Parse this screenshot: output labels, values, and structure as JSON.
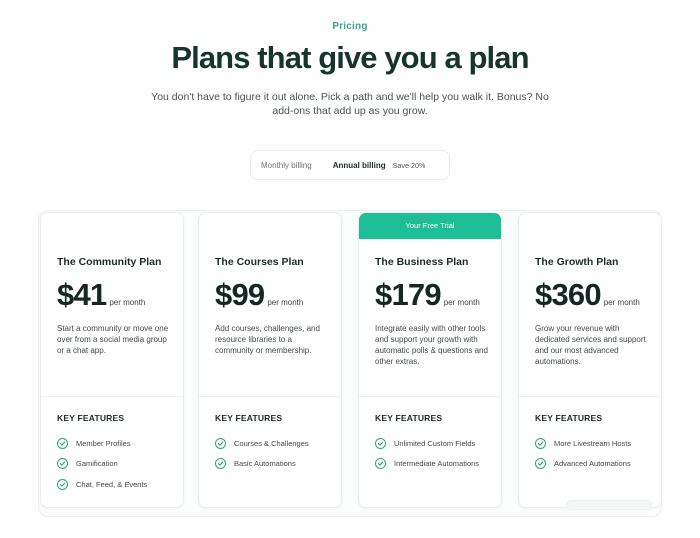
{
  "header": {
    "eyebrow": "Pricing",
    "title": "Plans that give you a plan",
    "subtitle": "You don't have to figure it out alone. Pick a path and we'll help you walk it. Bonus? No add-ons that add up as you grow."
  },
  "billing": {
    "monthly_label": "Monthly billing",
    "annual_label": "Annual billing",
    "save_label": "Save 20%",
    "selected": "Annual billing"
  },
  "plans": [
    {
      "name": "The Community Plan",
      "price": "$41",
      "period": "per month",
      "description": "Start a community or move one over from a social media group or a chat app.",
      "features_heading": "KEY FEATURES",
      "features": [
        "Member Profiles",
        "Gamification",
        "Chat, Feed, & Events"
      ]
    },
    {
      "name": "The Courses Plan",
      "price": "$99",
      "period": "per month",
      "description": "Add courses, challenges, and resource libraries to a community or membership.",
      "features_heading": "KEY FEATURES",
      "features": [
        "Courses & Challenges",
        "Basic Automations"
      ]
    },
    {
      "banner": "Your Free Trial",
      "name": "The Business Plan",
      "price": "$179",
      "period": "per month",
      "description": "Integrate easily with other tools and support your growth with automatic polls & questions and other extras.",
      "features_heading": "KEY FEATURES",
      "features": [
        "Unlimited Custom Fields",
        "Intermediate Automations"
      ]
    },
    {
      "name": "The Growth Plan",
      "price": "$360",
      "period": "per month",
      "description": "Grow your revenue with dedicated services and support and our most advanced automations.",
      "features_heading": "KEY FEATURES",
      "features": [
        "More Livestream Hosts",
        "Advanced Automations"
      ]
    }
  ],
  "colors": {
    "accent": "#1ebf97",
    "title": "#15352d",
    "check": "#2aa37f"
  }
}
